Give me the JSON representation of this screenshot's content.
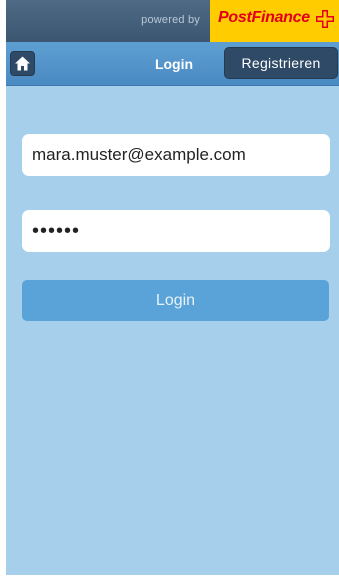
{
  "header": {
    "powered_by": "powered by",
    "brand": "PostFinance",
    "brand_colors": {
      "background": "#ffcc00",
      "text": "#e2001a"
    }
  },
  "navbar": {
    "home_icon": "home-icon",
    "title": "Login",
    "register_label": "Registrieren"
  },
  "form": {
    "email_value": "mara.muster@example.com",
    "password_value": "••••••",
    "login_label": "Login"
  },
  "colors": {
    "page_background": "#a6cfec",
    "navbar": "#4a8ac2",
    "dark_button": "#2f4a66",
    "login_button": "#5aa3d8"
  }
}
